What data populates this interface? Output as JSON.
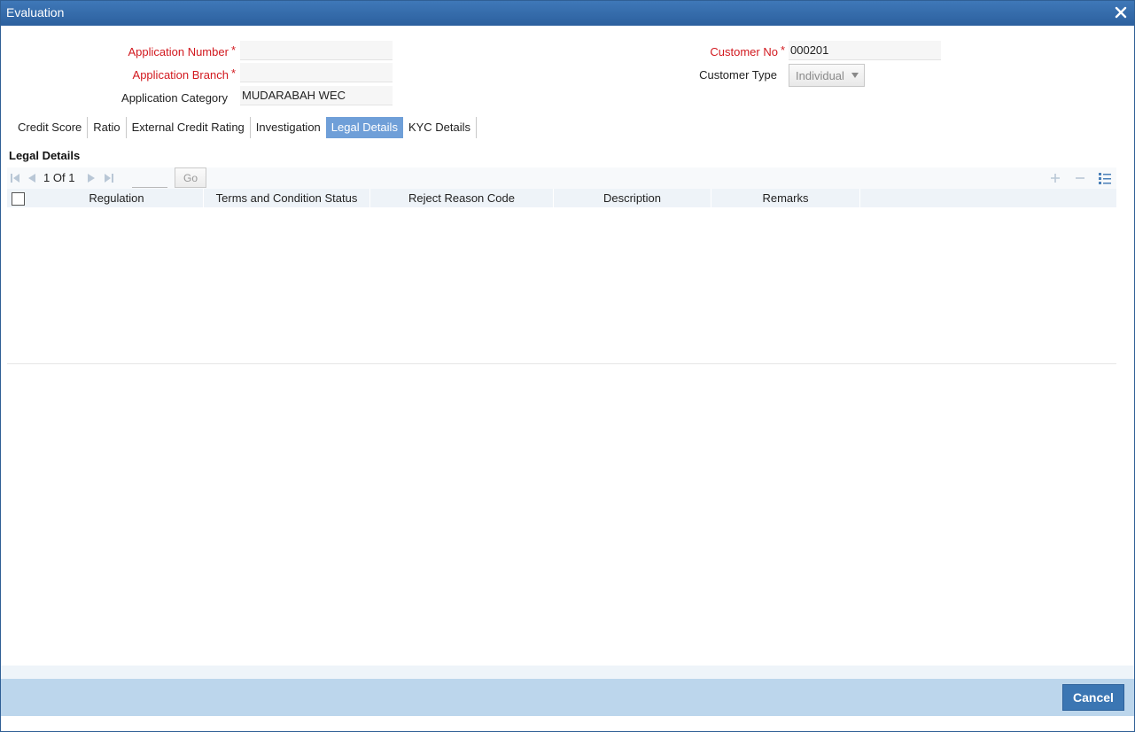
{
  "window": {
    "title": "Evaluation",
    "close_icon": "close-icon"
  },
  "header": {
    "application_number": {
      "label": "Application Number",
      "value": ""
    },
    "application_branch": {
      "label": "Application Branch",
      "value": ""
    },
    "application_category": {
      "label": "Application Category",
      "value": "MUDARABAH WEC"
    },
    "customer_no": {
      "label": "Customer No",
      "value": "000201"
    },
    "customer_type": {
      "label": "Customer Type",
      "value": "Individual"
    },
    "required_marker": "*"
  },
  "tabs": [
    {
      "label": "Credit Score",
      "active": false
    },
    {
      "label": "Ratio",
      "active": false
    },
    {
      "label": "External Credit Rating",
      "active": false
    },
    {
      "label": "Investigation",
      "active": false
    },
    {
      "label": "Legal Details",
      "active": true
    },
    {
      "label": "KYC Details",
      "active": false
    }
  ],
  "legal_details": {
    "title": "Legal Details",
    "pagination": {
      "current": "1",
      "of_label": "Of",
      "total": "1",
      "go_label": "Go"
    },
    "columns": [
      "Regulation",
      "Terms and Condition Status",
      "Reject Reason Code",
      "Description",
      "Remarks"
    ],
    "rows": []
  },
  "footer": {
    "cancel_label": "Cancel"
  },
  "colors": {
    "titlebar": "#2c609e",
    "active_tab": "#6f9fd8",
    "footer": "#bcd6ec",
    "required": "#d2191f",
    "button": "#3b76b3"
  }
}
